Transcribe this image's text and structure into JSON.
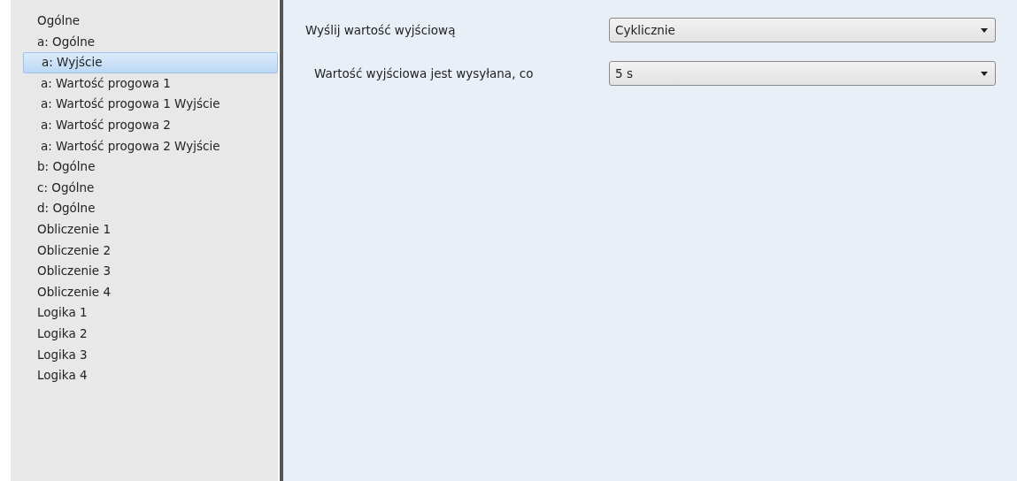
{
  "sidebar": {
    "items": [
      {
        "label": "Ogólne",
        "selected": false
      },
      {
        "label": "a: Ogólne",
        "selected": false,
        "children": [
          {
            "label": "a: Wyjście",
            "selected": true
          },
          {
            "label": "a: Wartość progowa 1",
            "selected": false
          },
          {
            "label": "a: Wartość progowa 1 Wyjście",
            "selected": false
          },
          {
            "label": "a: Wartość progowa 2",
            "selected": false
          },
          {
            "label": "a: Wartość progowa 2 Wyjście",
            "selected": false
          }
        ]
      },
      {
        "label": "b: Ogólne",
        "selected": false
      },
      {
        "label": "c: Ogólne",
        "selected": false
      },
      {
        "label": "d: Ogólne",
        "selected": false
      },
      {
        "label": "Obliczenie 1",
        "selected": false
      },
      {
        "label": "Obliczenie 2",
        "selected": false
      },
      {
        "label": "Obliczenie 3",
        "selected": false
      },
      {
        "label": "Obliczenie 4",
        "selected": false
      },
      {
        "label": "Logika 1",
        "selected": false
      },
      {
        "label": "Logika 2",
        "selected": false
      },
      {
        "label": "Logika 3",
        "selected": false
      },
      {
        "label": "Logika 4",
        "selected": false
      }
    ]
  },
  "parameters": [
    {
      "label": "Wyślij wartość wyjściową",
      "value": "Cyklicznie",
      "children": [
        {
          "label": "Wartość wyjściowa jest wysyłana, co",
          "value": "5 s"
        }
      ]
    }
  ]
}
